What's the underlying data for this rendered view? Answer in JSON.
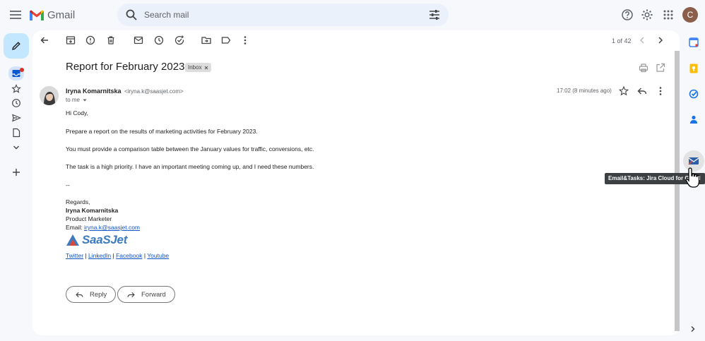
{
  "app": {
    "name": "Gmail",
    "avatar_letter": "C"
  },
  "search": {
    "placeholder": "Search mail"
  },
  "toolbar": {
    "counter": "1 of 42"
  },
  "message": {
    "subject": "Report for February 2023",
    "label": "Inbox",
    "sender_name": "Iryna Komarnitska",
    "sender_email": "<iryna.k@saasjet.com>",
    "to": "to me",
    "timestamp": "17:02 (8 minutes ago)",
    "body": [
      "Hi Cody,",
      "Prepare a report on the results of marketing activities for February 2023.",
      "You must provide a comparison table between the January values for traffic, conversions, etc.",
      "The task is a high priority. I have an important meeting coming up, and I need these numbers."
    ],
    "signature": {
      "dashes": "--",
      "regards": "Regards,",
      "name": "Iryna Komarnitska",
      "title": "Product Marketer",
      "email_label": "Email:",
      "email": "iryna.k@saasjet.com",
      "brand": "SaaSJet",
      "social": [
        "Twitter",
        "LinkedIn",
        "Facebook",
        "Youtube"
      ],
      "separator": "|"
    }
  },
  "actions": {
    "reply": "Reply",
    "forward": "Forward"
  },
  "tooltip": "Email&Tasks: Jira Cloud for Gmail",
  "colors": {
    "accent": "#0b57d0",
    "compose_bg": "#c2e7ff",
    "link": "#1155cc"
  }
}
